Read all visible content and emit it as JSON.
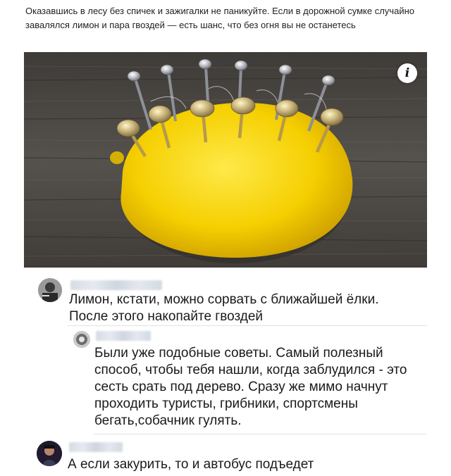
{
  "post": {
    "text": "Оказавшись в лесу без спичек и зажигалки не паникуйте. Если в дорожной сумке случайно завалялся лимон и пара гвоздей — есть шанс, что без огня вы не останетесь",
    "image": {
      "description_icon": "info-icon",
      "info_label": "i"
    }
  },
  "comments": [
    {
      "author": "",
      "avatar": "avatar-photo",
      "text": "Лимон, кстати, можно сорвать с ближайшей ёлки. После этого накопайте гвоздей"
    },
    {
      "author": "",
      "avatar": "avatar-photo",
      "reply": true,
      "text": "Были уже подобные советы. Самый полезный способ, чтобы тебя нашли, когда заблудился - это сесть срать под дерево. Сразу же мимо начнут проходить туристы, грибники, спортсмены бегать,собачник гулять."
    },
    {
      "author": "",
      "avatar": "avatar-photo",
      "text": "А если закурить, то и автобус подъедет"
    }
  ],
  "colors": {
    "background": "#ffffff",
    "lemon": "#f4d000",
    "wood": "#4a4642",
    "divider": "#e3e3e3"
  }
}
